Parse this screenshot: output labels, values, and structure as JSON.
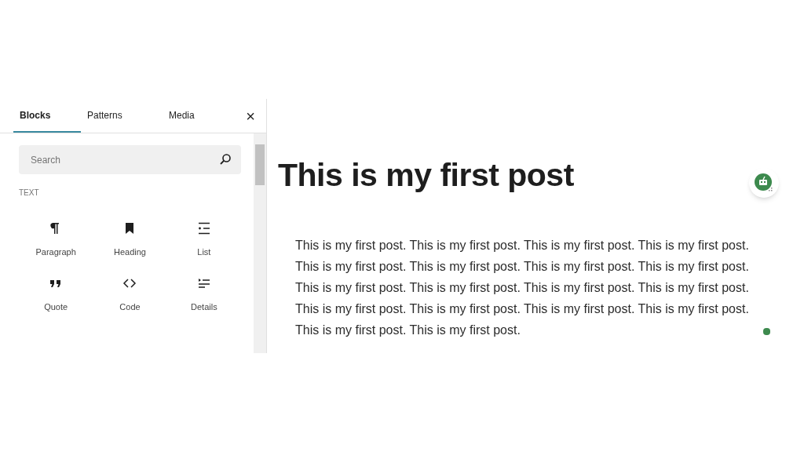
{
  "inserter": {
    "tabs": [
      {
        "label": "Blocks",
        "selected": true
      },
      {
        "label": "Patterns",
        "selected": false
      },
      {
        "label": "Media",
        "selected": false
      }
    ],
    "close": "×",
    "search": {
      "placeholder": "Search"
    },
    "category": "TEXT",
    "blocks": [
      {
        "kind": "paragraph",
        "label": "Paragraph"
      },
      {
        "kind": "heading",
        "label": "Heading"
      },
      {
        "kind": "list",
        "label": "List"
      },
      {
        "kind": "quote",
        "label": "Quote"
      },
      {
        "kind": "code",
        "label": "Code"
      },
      {
        "kind": "details",
        "label": "Details"
      }
    ]
  },
  "editor": {
    "title": "This is my first post",
    "paragraph": "This is my first post. This is my first post. This is my first post. This is my first post. This is my first post. This is my first post. This is my first post. This is my first post. This is my first post. This is my first post. This is my first post. This is my first post. This is my first post. This is my first post. This is my first post. This is my first post. This is my first post. This is my first post."
  }
}
